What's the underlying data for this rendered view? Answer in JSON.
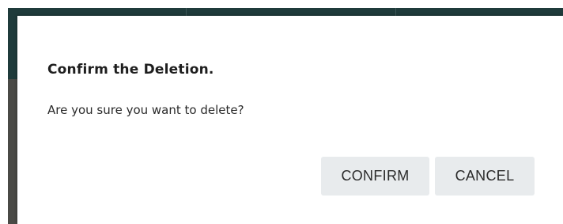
{
  "dialog": {
    "title": "Confirm the Deletion.",
    "message": "Are you sure you want to delete?",
    "confirm_label": "CONFIRM",
    "cancel_label": "CANCEL"
  },
  "colors": {
    "backdrop_top": "#1f3b3b",
    "backdrop_left": "#4a4a46",
    "dialog_background": "#ffffff",
    "button_background": "#e8ebed",
    "button_text": "#2b2b2b",
    "title_text": "#1e1e1e"
  }
}
